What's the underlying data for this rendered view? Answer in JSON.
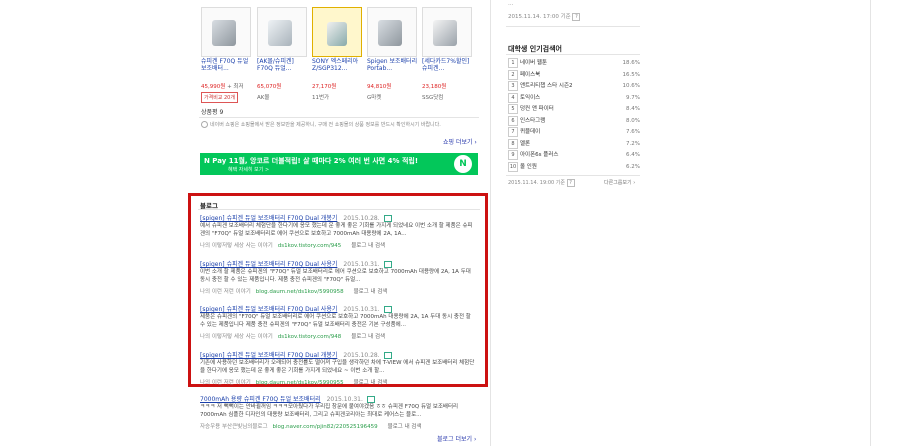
{
  "right_top_date": "2015.11.14. 17:00 기준",
  "help_mark": "?",
  "products": [
    {
      "title": "슈피겐 F70Q 듀얼 보조배터...",
      "price": "45,990원",
      "store": "+ 최저",
      "badge": "가격비교 20개"
    },
    {
      "title": "[AK몰/슈피겐] F70Q 듀얼...",
      "price": "65,070원",
      "store": "AK몰"
    },
    {
      "title": "SONY 엑스페리아Z/SGP312...",
      "price": "27,170원",
      "store": "11번가"
    },
    {
      "title": "Spigen 보조배터리 Portab...",
      "price": "94,810원",
      "store": "G마켓"
    },
    {
      "title": "[세다카드7%할인] 슈피겐...",
      "price": "23,180원",
      "store": "SSG닷컴"
    }
  ],
  "product_count_label": "상품평 9",
  "notice": "네이버 쇼핑은 쇼핑몰에서 받은 정보만을 제공하니, 구매 전 쇼핑몰의 상품 정보를 반드시 확인하시기 바랍니다.",
  "shopping_more": "쇼핑 더보기",
  "banner": {
    "logo": "N Pay",
    "text": "11월, 앙코르 더블적립! 살 때마다 2% 여러 번 사면 4% 적립!",
    "sub": "혜택 자세히 보기 >"
  },
  "blog_section_label": "블로그",
  "blogs": [
    {
      "title": "[spigen] 슈피겐 듀얼 보조배터리 F70Q Dual 개봉기",
      "date": "2015.10.28.",
      "desc": "예서 슈피겐 보조배터리 체험단을 한다기에 응모 했는데 운 좋게 좋은 기회를 가지게 되었네요 이번 소개 할 제품은 슈피겐의 \"F70Q\" 듀얼 보조배터리로 에어 쿠션으로 보호하고 7000mAh 대용량에 2A, 1A...",
      "author": "나의 이렇저렇 세상 사는 이야기",
      "url": "ds1kov.tistory.com/945",
      "inblog": "블로그 내 검색"
    },
    {
      "title": "[spigen] 슈피겐 듀얼 보조배터리 F70Q Dual 사용기",
      "date": "2015.10.31.",
      "desc": "이번 소개 할 제품은 슈피겐의 \"F70Q\" 듀얼 보조배터리로 에어 쿠션으로 보호하고 7000mAh 대용량에 2A, 1A 두대 동시 충전 할 수 있는 제품입니다. 제품 충전 슈피겐의 \"F70Q\" 듀얼...",
      "author": "나의 이런 저런 이야기",
      "url": "blog.daum.net/ds1kov/5990958",
      "inblog": "블로그 내 검색"
    },
    {
      "title": "[spigen] 슈피겐 듀얼 보조배터리 F70Q Dual 사용기",
      "date": "2015.10.31.",
      "desc": "제품은 슈피겐의 \"F70Q\" 듀얼 보조배터리로 에어 쿠션으로 보호하고 7000mAh 대용량에 2A, 1A 두대 동시 충전 할 수 있는 제품입니다 제품 충전 슈피겐의 \"F70Q\" 듀얼 보조배터리 충전은 기본 구성품에...",
      "author": "나의 이렇저렇 세상 사는 이야기",
      "url": "ds1kov.tistory.com/948",
      "inblog": "블로그 내 검색"
    },
    {
      "title": "[spigen] 슈피겐 듀얼 보조배터리 F70Q Dual 개봉기",
      "date": "2015.10.28.",
      "desc": "기존에 사용하던 보조배터리가 오래되어 충전률도 떨어져 구입을 생각하던 차에 T-VIEW 에서 슈피겐 보조배터리 체험단을 한다기에 응모 했는데 운 좋게 좋은 기회를 가지게 되었네요 ~ 이번 소개 할...",
      "author": "나의 이런 저런 이야기",
      "url": "blog.daum.net/ds1kov/5990955",
      "inblog": "블로그 내 검색"
    },
    {
      "title": "7000mAh 용량 슈피겐 F70Q 듀얼 보조배터리",
      "date": "2015.10.31.",
      "desc": "ㅋㅋㅋ 저 뻑뻑이는 안바뀔꺼임 ㅋㅋㅋ모아뒀다가 우리집 창문에 붙여야겠음 ㅎㅎ 슈피겐 F70Q 듀얼 보조배터리 7000mAh 심플한 디자인의 대용량 보조배터리, 그리고 슈피겐코리아는 최대로 케어스는 블로...",
      "author": "자승우용 부산큰빛님의블로그",
      "url": "blog.naver.com/pjin82/220525196459",
      "inblog": "블로그 내 검색"
    }
  ],
  "blog_more": "블로그 더보기",
  "ranking": {
    "title": "대학생 인기검색어",
    "items": [
      {
        "num": "1",
        "name": "네이버 웹툰",
        "pct": "18.6%"
      },
      {
        "num": "2",
        "name": "페이스북",
        "pct": "16.5%"
      },
      {
        "num": "3",
        "name": "앤트리티챕 스타 시즌2",
        "pct": "10.6%"
      },
      {
        "num": "4",
        "name": "토익이스",
        "pct": "9.7%"
      },
      {
        "num": "5",
        "name": "덩컨 앤 파이터",
        "pct": "8.4%"
      },
      {
        "num": "6",
        "name": "인스타그램",
        "pct": "8.0%"
      },
      {
        "num": "7",
        "name": "퀴블데이",
        "pct": "7.6%"
      },
      {
        "num": "8",
        "name": "멜론",
        "pct": "7.2%"
      },
      {
        "num": "9",
        "name": "아이폰6s 플러스",
        "pct": "6.4%"
      },
      {
        "num": "10",
        "name": "올 인원",
        "pct": "6.2%"
      }
    ],
    "date": "2015.11.14. 19:00 기준",
    "prev": "다른그룹보기"
  },
  "colors": {
    "highlight_border": "#cc1111",
    "banner_bg": "#03c75a",
    "link": "#1a3faa",
    "url": "#2a9d4a"
  }
}
